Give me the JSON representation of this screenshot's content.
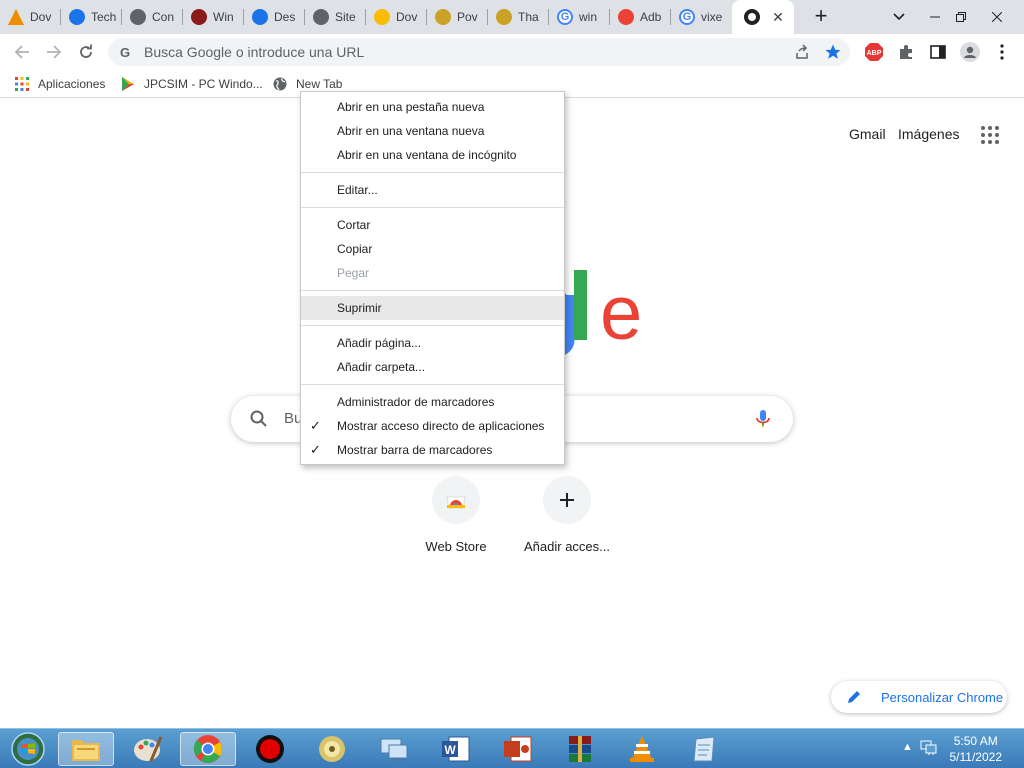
{
  "tabs": [
    {
      "title": "Dov",
      "icon": "vlc-icon",
      "color": "#f08c00"
    },
    {
      "title": "Tech",
      "icon": "chrome-blue-icon",
      "color": "#1a73e8"
    },
    {
      "title": "Con",
      "icon": "gear-icon",
      "color": "#5f6368"
    },
    {
      "title": "Win",
      "icon": "winrar-icon",
      "color": "#8b1a1a"
    },
    {
      "title": "Des",
      "icon": "download-icon",
      "color": "#1a73e8"
    },
    {
      "title": "Site",
      "icon": "globe-icon",
      "color": "#5f6368"
    },
    {
      "title": "Dov",
      "icon": "tab-icon",
      "color": "#fbbc05"
    },
    {
      "title": "Pov",
      "icon": "tab-icon",
      "color": "#c9a227"
    },
    {
      "title": "Tha",
      "icon": "tab-icon",
      "color": "#c9a227"
    },
    {
      "title": "win",
      "icon": "google-icon",
      "color": "#4285f4"
    },
    {
      "title": "Adb",
      "icon": "web-store-icon",
      "color": "#ea4335"
    },
    {
      "title": "vixe",
      "icon": "google-icon",
      "color": "#4285f4"
    },
    {
      "title": "",
      "icon": "chrome-icon",
      "color": "#202124"
    }
  ],
  "toolbar": {
    "omnibox_placeholder": "Busca Google o introduce una URL"
  },
  "bookmarks": [
    {
      "label": "Aplicaciones",
      "icon": "apps-grid-icon"
    },
    {
      "label": "JPCSIM - PC Windo...",
      "icon": "play-store-icon"
    },
    {
      "label": "New Tab",
      "icon": "globe-icon"
    }
  ],
  "page": {
    "gmail": "Gmail",
    "images": "Imágenes",
    "logo_partial": "gle",
    "search_partial": "Bu",
    "shortcuts": [
      {
        "label": "Web Store",
        "icon": "web-store-icon"
      },
      {
        "label": "Añadir acces...",
        "icon": "plus-icon"
      }
    ],
    "customize": "Personalizar Chrome"
  },
  "context_menu": {
    "groups": [
      [
        {
          "label": "Abrir en una pestaña nueva",
          "enabled": true
        },
        {
          "label": "Abrir en una ventana nueva",
          "enabled": true
        },
        {
          "label": "Abrir en una ventana de incógnito",
          "enabled": true
        }
      ],
      [
        {
          "label": "Editar...",
          "enabled": true
        }
      ],
      [
        {
          "label": "Cortar",
          "enabled": true
        },
        {
          "label": "Copiar",
          "enabled": true
        },
        {
          "label": "Pegar",
          "enabled": false
        }
      ],
      [
        {
          "label": "Suprimir",
          "enabled": true,
          "highlighted": true
        }
      ],
      [
        {
          "label": "Añadir página...",
          "enabled": true
        },
        {
          "label": "Añadir carpeta...",
          "enabled": true
        }
      ],
      [
        {
          "label": "Administrador de marcadores",
          "enabled": true
        },
        {
          "label": "Mostrar acceso directo de aplicaciones",
          "enabled": true,
          "checked": true
        },
        {
          "label": "Mostrar barra de marcadores",
          "enabled": true,
          "checked": true
        }
      ]
    ]
  },
  "taskbar": {
    "time": "5:50 AM",
    "date": "5/11/2022"
  }
}
